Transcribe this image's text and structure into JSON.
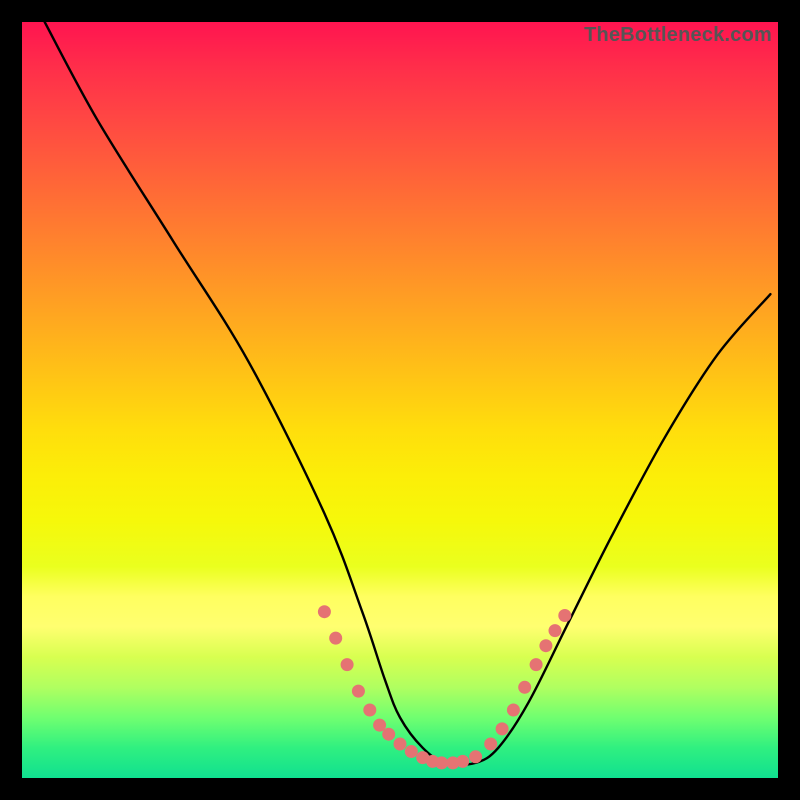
{
  "watermark": "TheBottleneck.com",
  "colors": {
    "curve": "#000000",
    "dots": "#e57373",
    "background_top": "#ff1450",
    "background_bottom": "#10e090"
  },
  "chart_data": {
    "type": "line",
    "title": "",
    "xlabel": "",
    "ylabel": "",
    "xlim": [
      0,
      100
    ],
    "ylim": [
      0,
      100
    ],
    "grid": false,
    "series": [
      {
        "name": "bottleneck-curve",
        "x": [
          3,
          10,
          20,
          30,
          40,
          45,
          48,
          50,
          53,
          56,
          60,
          63,
          67,
          72,
          78,
          85,
          92,
          99
        ],
        "y": [
          100,
          87,
          71,
          55,
          35,
          22,
          13,
          8,
          4,
          2,
          2,
          4,
          10,
          20,
          32,
          45,
          56,
          64
        ]
      }
    ],
    "highlight_points": {
      "name": "highlighted-range",
      "x": [
        40,
        41.5,
        43,
        44.5,
        46,
        47.3,
        48.5,
        50,
        51.5,
        53,
        54.3,
        55.5,
        57,
        58.3,
        60,
        62,
        63.5,
        65,
        66.5,
        68,
        69.3,
        70.5,
        71.8
      ],
      "y": [
        22,
        18.5,
        15,
        11.5,
        9,
        7,
        5.8,
        4.5,
        3.5,
        2.7,
        2.2,
        2,
        2,
        2.2,
        2.8,
        4.5,
        6.5,
        9,
        12,
        15,
        17.5,
        19.5,
        21.5
      ]
    }
  }
}
